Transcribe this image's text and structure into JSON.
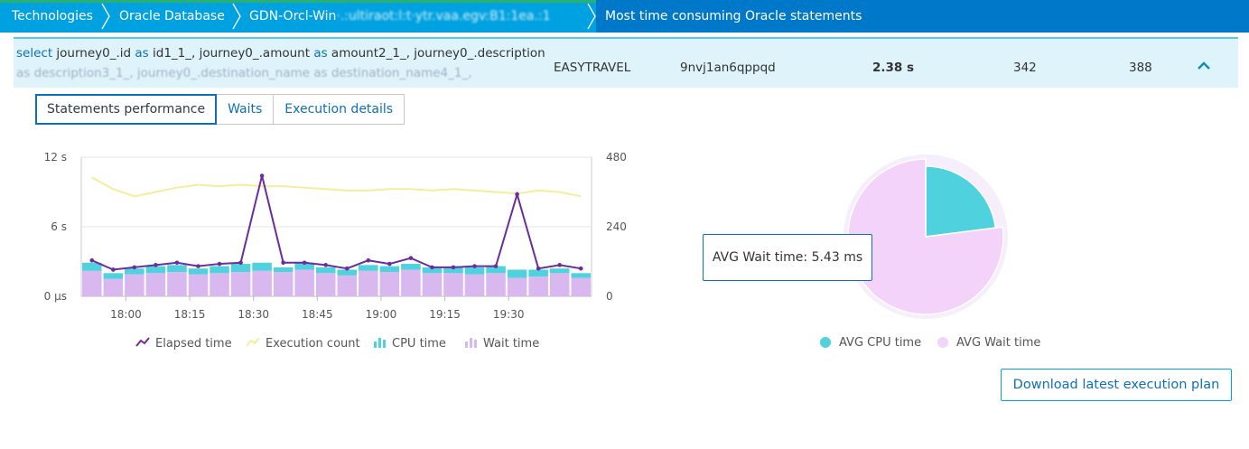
{
  "breadcrumb": {
    "items": [
      "Technologies",
      "Oracle Database",
      "GDN-Orcl-Win"
    ],
    "host_redacted": "·.:ultiraot:l:t·ytr.vaa.egv:B1:1ea.:1",
    "current": "Most time consuming Oracle statements"
  },
  "statement": {
    "sql_line1": [
      {
        "t": "select",
        "kw": true
      },
      {
        "t": " journey0_.id ",
        "kw": false
      },
      {
        "t": "as",
        "kw": true
      },
      {
        "t": " id1_1_, journey0_.amount ",
        "kw": false
      },
      {
        "t": "as",
        "kw": true
      },
      {
        "t": " amount2_1_, journey0_.description",
        "kw": false
      }
    ],
    "sql_line2": "as description3_1_, journey0_.destination_name as destination_name4_1_,",
    "schema": "EASYTRAVEL",
    "sql_id": "9nvj1an6qppqd",
    "total_time": "2.38 s",
    "executions": "342",
    "metric": "388"
  },
  "tabs": [
    "Statements performance",
    "Waits",
    "Execution details"
  ],
  "active_tab": 0,
  "chart_data": {
    "type": "bar",
    "x_ticks": [
      "18:00",
      "18:15",
      "18:30",
      "18:45",
      "19:00",
      "19:15",
      "19:30"
    ],
    "y_left_ticks": [
      "12 s",
      "6 s",
      "0 µs"
    ],
    "y_right_ticks": [
      "480",
      "240",
      "0"
    ],
    "y_left_range": [
      0,
      12
    ],
    "y_right_range": [
      0,
      480
    ],
    "x_start": "17:52",
    "x_step_minutes": 5,
    "series": [
      {
        "name": "Wait time",
        "color": "#d9b8f0",
        "axis": "left",
        "values": [
          2.2,
          1.5,
          1.9,
          2.0,
          2.1,
          1.9,
          2.0,
          2.1,
          2.2,
          2.1,
          2.3,
          2.0,
          1.8,
          2.2,
          2.1,
          2.3,
          2.0,
          2.0,
          1.9,
          2.0,
          1.6,
          1.7,
          2.0,
          1.6
        ]
      },
      {
        "name": "CPU time",
        "color": "#4fd1de",
        "axis": "left",
        "values": [
          0.7,
          0.5,
          0.5,
          0.6,
          0.6,
          0.5,
          0.6,
          0.7,
          0.7,
          0.4,
          0.6,
          0.5,
          0.5,
          0.5,
          0.5,
          0.5,
          0.5,
          0.5,
          0.6,
          0.6,
          0.7,
          0.6,
          0.4,
          0.4
        ]
      },
      {
        "name": "Elapsed time",
        "color": "#6a2e9a",
        "axis": "left",
        "values": [
          3.1,
          2.3,
          2.5,
          2.7,
          2.9,
          2.6,
          2.8,
          2.9,
          10.4,
          2.9,
          2.9,
          2.7,
          2.4,
          3.1,
          2.8,
          3.3,
          2.5,
          2.5,
          2.6,
          2.6,
          8.8,
          2.4,
          2.7,
          2.4
        ]
      },
      {
        "name": "Execution count",
        "color": "#f4ed9b",
        "axis": "right",
        "values": [
          410,
          370,
          345,
          360,
          375,
          385,
          380,
          385,
          380,
          380,
          375,
          370,
          365,
          365,
          370,
          370,
          365,
          370,
          365,
          360,
          355,
          365,
          360,
          345
        ]
      }
    ]
  },
  "pie": {
    "slices": [
      {
        "name": "AVG CPU time",
        "value": 23,
        "color": "#4fd1de"
      },
      {
        "name": "AVG Wait time",
        "value": 77,
        "color": "#f3d3fa"
      }
    ],
    "tooltip": "AVG Wait time: 5.43 ms"
  },
  "download_label": "Download latest execution plan"
}
